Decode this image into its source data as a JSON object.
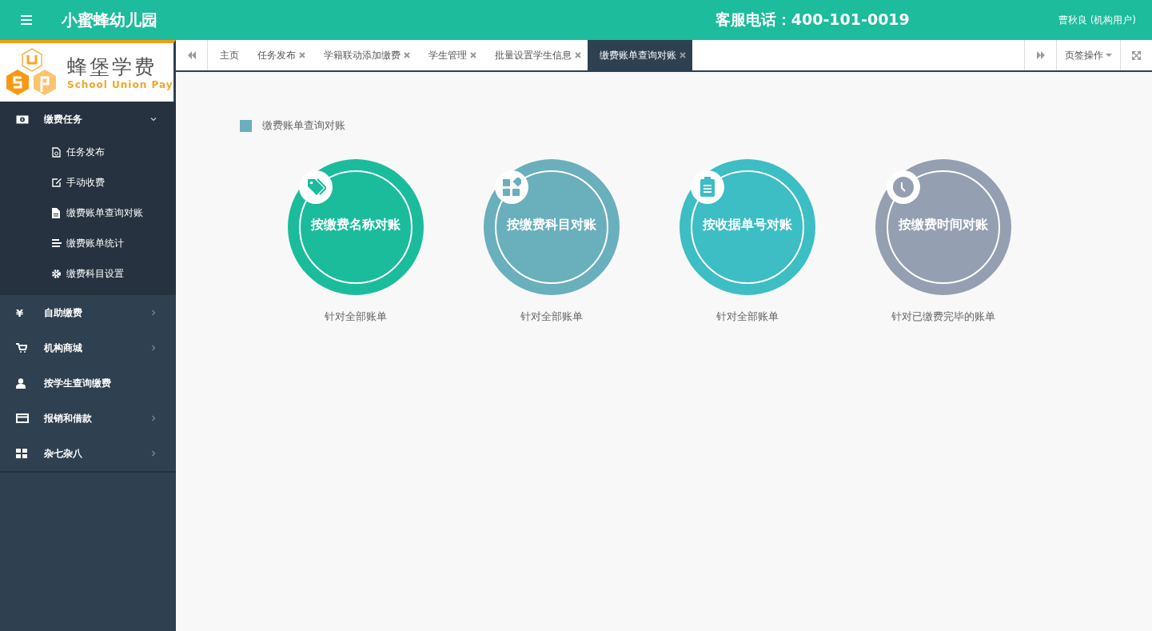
{
  "header": {
    "title": "小蜜蜂幼儿园",
    "hotline": "客服电话：400-101-0019",
    "user": "曹秋良 (机构用户)"
  },
  "logo": {
    "name": "蜂堡学费",
    "subtitle": "School Union Pay"
  },
  "sidebar": {
    "items": [
      {
        "label": "缴费任务",
        "kind": "group",
        "expanded": true,
        "children": [
          {
            "label": "任务发布"
          },
          {
            "label": "手动收费"
          },
          {
            "label": "缴费账单查询对账"
          },
          {
            "label": "缴费账单统计"
          },
          {
            "label": "缴费科目设置"
          }
        ]
      },
      {
        "label": "自助缴费",
        "kind": "group",
        "expanded": false,
        "icon_text": "¥"
      },
      {
        "label": "机构商城",
        "kind": "group",
        "expanded": false
      },
      {
        "label": "按学生查询缴费",
        "kind": "link"
      },
      {
        "label": "报销和借款",
        "kind": "group",
        "expanded": false
      },
      {
        "label": "杂七杂八",
        "kind": "group",
        "expanded": false
      }
    ]
  },
  "tabs": [
    {
      "label": "主页",
      "closable": false,
      "selected": false
    },
    {
      "label": "任务发布",
      "closable": true,
      "selected": false
    },
    {
      "label": "学籍联动添加缴费",
      "closable": true,
      "selected": false
    },
    {
      "label": "学生管理",
      "closable": true,
      "selected": false
    },
    {
      "label": "批量设置学生信息",
      "closable": true,
      "selected": false
    },
    {
      "label": "缴费账单查询对账",
      "closable": true,
      "selected": true
    }
  ],
  "tab_actions": {
    "menu": "页签操作"
  },
  "section": {
    "title": "缴费账单查询对账"
  },
  "cards": [
    {
      "title": "按缴费名称对账",
      "subtitle": "针对全部账单",
      "color": "#1abc9c"
    },
    {
      "title": "按缴费科目对账",
      "subtitle": "针对全部账单",
      "color": "#6aafbc"
    },
    {
      "title": "按收据单号对账",
      "subtitle": "针对全部账单",
      "color": "#3dbdc4"
    },
    {
      "title": "按缴费时间对账",
      "subtitle": "针对已缴费完毕的账单",
      "color": "#949fb1"
    }
  ]
}
